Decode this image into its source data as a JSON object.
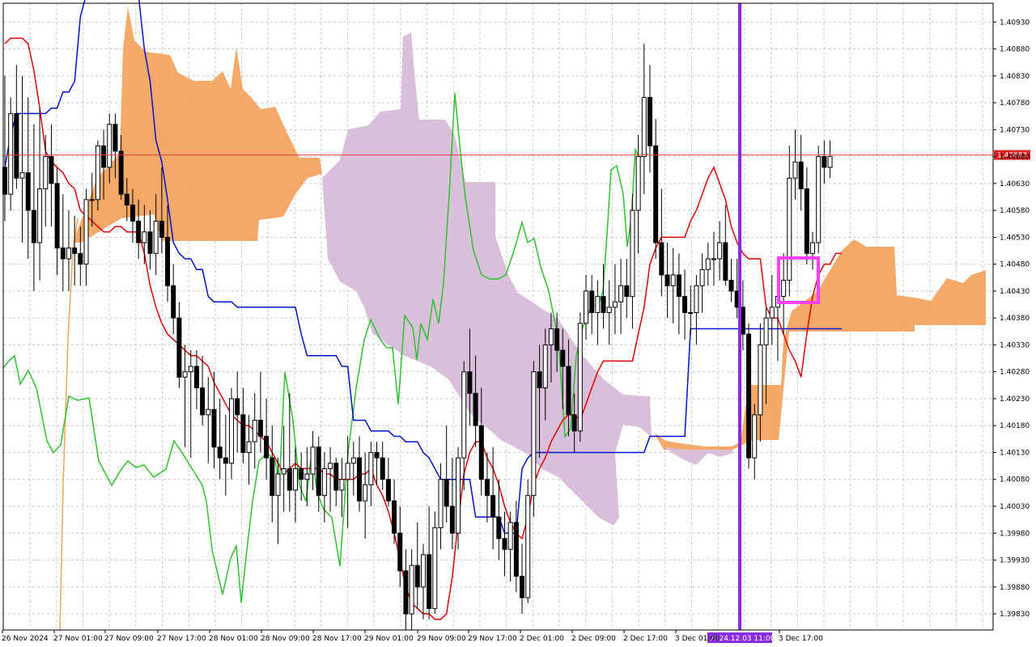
{
  "chart_data": {
    "type": "line",
    "symbol_hidden": true,
    "title": "",
    "y_axis": {
      "ticks": [
        "1.40930",
        "1.40880",
        "1.40830",
        "1.40780",
        "1.40730",
        "1.40680",
        "1.40630",
        "1.40580",
        "1.40530",
        "1.40480",
        "1.40430",
        "1.40380",
        "1.40330",
        "1.40280",
        "1.40230",
        "1.40180",
        "1.40130",
        "1.40080",
        "1.40030",
        "1.39980",
        "1.39930",
        "1.39880",
        "1.39830"
      ],
      "ylim": [
        1.398,
        1.40965
      ]
    },
    "x_axis": {
      "ticks": [
        "26 Nov 2024",
        "27 Nov 01:00",
        "27 Nov 09:00",
        "27 Nov 17:00",
        "28 Nov 01:00",
        "28 Nov 09:00",
        "28 Nov 17:00",
        "29 Nov 01:00",
        "29 Nov 09:00",
        "29 Nov 17:00",
        "2 Dec 01:00",
        "2 Dec 09:00",
        "2 Dec 17:00",
        "3 Dec 01:00",
        "3 Dec 17:00"
      ],
      "highlight_label": "2024.12.03 11:00"
    },
    "current_price": "1.40683",
    "colors": {
      "background": "#ffffff",
      "grid": "#c8c8c8",
      "bull": "#ffffff",
      "bear": "#000000",
      "tenkan": "#e00000",
      "kijun": "#0010d0",
      "chikou": "#30c030",
      "cloud_bull": "#f4a460",
      "cloud_bear": "#d8bcd8",
      "vline": "#8a2be2",
      "marker": "#ff40ff",
      "price_line": "#e04040",
      "price_tag_bg": "#e02020",
      "time_tag_bg": "#8a2be2"
    },
    "candles": [
      [
        1.4066,
        1.4083,
        1.4056,
        1.4061
      ],
      [
        1.4061,
        1.4079,
        1.4058,
        1.4076
      ],
      [
        1.4076,
        1.4085,
        1.4062,
        1.4064
      ],
      [
        1.4064,
        1.4083,
        1.4052,
        1.4065
      ],
      [
        1.4065,
        1.4079,
        1.4049,
        1.4058
      ],
      [
        1.4058,
        1.4074,
        1.4043,
        1.4052
      ],
      [
        1.4052,
        1.4077,
        1.4045,
        1.4062
      ],
      [
        1.4062,
        1.4072,
        1.4055,
        1.4068
      ],
      [
        1.4068,
        1.4074,
        1.4055,
        1.4063
      ],
      [
        1.4063,
        1.4066,
        1.4046,
        1.4051
      ],
      [
        1.4051,
        1.4061,
        1.4043,
        1.4049
      ],
      [
        1.4049,
        1.4058,
        1.4043,
        1.4051
      ],
      [
        1.4051,
        1.4057,
        1.4044,
        1.405
      ],
      [
        1.405,
        1.4055,
        1.4044,
        1.4048
      ],
      [
        1.4048,
        1.4062,
        1.4044,
        1.406
      ],
      [
        1.406,
        1.4065,
        1.4055,
        1.406
      ],
      [
        1.406,
        1.4071,
        1.4058,
        1.407
      ],
      [
        1.407,
        1.4073,
        1.406,
        1.4066
      ],
      [
        1.4066,
        1.4076,
        1.4063,
        1.4074
      ],
      [
        1.4074,
        1.4076,
        1.4064,
        1.4069
      ],
      [
        1.4069,
        1.4072,
        1.406,
        1.4061
      ],
      [
        1.4061,
        1.4064,
        1.4056,
        1.4059
      ],
      [
        1.4059,
        1.4062,
        1.4052,
        1.4056
      ],
      [
        1.4056,
        1.406,
        1.4049,
        1.4052
      ],
      [
        1.4052,
        1.4059,
        1.4048,
        1.4054
      ],
      [
        1.4054,
        1.4058,
        1.4047,
        1.405
      ],
      [
        1.405,
        1.4061,
        1.4046,
        1.4056
      ],
      [
        1.4056,
        1.4066,
        1.405,
        1.4053
      ],
      [
        1.4053,
        1.4059,
        1.4041,
        1.4044
      ],
      [
        1.4044,
        1.4048,
        1.4035,
        1.4038
      ],
      [
        1.4038,
        1.4041,
        1.4025,
        1.4027
      ],
      [
        1.4027,
        1.4033,
        1.4014,
        1.4028
      ],
      [
        1.4028,
        1.4032,
        1.4012,
        1.4029
      ],
      [
        1.4029,
        1.4032,
        1.4021,
        1.4025
      ],
      [
        1.4025,
        1.4031,
        1.4018,
        1.402
      ],
      [
        1.402,
        1.4027,
        1.4011,
        1.4021
      ],
      [
        1.4021,
        1.4028,
        1.401,
        1.4014
      ],
      [
        1.4014,
        1.4023,
        1.4008,
        1.4012
      ],
      [
        1.4012,
        1.402,
        1.4005,
        1.4011
      ],
      [
        1.4011,
        1.4025,
        1.4008,
        1.4023
      ],
      [
        1.4023,
        1.4028,
        1.4013,
        1.402
      ],
      [
        1.402,
        1.4025,
        1.4011,
        1.4013
      ],
      [
        1.4013,
        1.402,
        1.4007,
        1.4015
      ],
      [
        1.4015,
        1.4024,
        1.401,
        1.4019
      ],
      [
        1.4019,
        1.4028,
        1.4013,
        1.4016
      ],
      [
        1.4016,
        1.4023,
        1.4008,
        1.4012
      ],
      [
        1.4012,
        1.4018,
        1.4,
        1.4005
      ],
      [
        1.4005,
        1.4012,
        1.3996,
        1.4009
      ],
      [
        1.4009,
        1.4018,
        1.4002,
        1.401
      ],
      [
        1.401,
        1.4024,
        1.4002,
        1.4006
      ],
      [
        1.4006,
        1.4014,
        1.4,
        1.401
      ],
      [
        1.401,
        1.4013,
        1.4004,
        1.4008
      ],
      [
        1.4008,
        1.4014,
        1.4003,
        1.4009
      ],
      [
        1.4009,
        1.4017,
        1.4006,
        1.4014
      ],
      [
        1.4014,
        1.4016,
        1.4002,
        1.4005
      ],
      [
        1.4005,
        1.4013,
        1.4,
        1.401
      ],
      [
        1.401,
        1.4014,
        1.4002,
        1.4011
      ],
      [
        1.4011,
        1.4012,
        1.4003,
        1.4006
      ],
      [
        1.4006,
        1.4012,
        1.4001,
        1.4008
      ],
      [
        1.4008,
        1.4016,
        1.3999,
        1.4011
      ],
      [
        1.4011,
        1.4015,
        1.4005,
        1.4012
      ],
      [
        1.4012,
        1.4016,
        1.4002,
        1.4004
      ],
      [
        1.4004,
        1.4013,
        1.3997,
        1.4007
      ],
      [
        1.4007,
        1.4015,
        1.4003,
        1.4013
      ],
      [
        1.4013,
        1.4015,
        1.4007,
        1.4012
      ],
      [
        1.4012,
        1.4015,
        1.4006,
        1.4008
      ],
      [
        1.4008,
        1.4012,
        1.4003,
        1.4004
      ],
      [
        1.4004,
        1.4008,
        1.3996,
        1.3998
      ],
      [
        1.3998,
        1.4003,
        1.3988,
        1.3991
      ],
      [
        1.3991,
        1.3995,
        1.398,
        1.3983
      ],
      [
        1.3983,
        1.3995,
        1.398,
        1.3992
      ],
      [
        1.3992,
        1.4,
        1.3984,
        1.3988
      ],
      [
        1.3988,
        1.3996,
        1.3982,
        1.3994
      ],
      [
        1.3994,
        1.4003,
        1.3982,
        1.3984
      ],
      [
        1.3984,
        1.4002,
        1.3983,
        1.3999
      ],
      [
        1.3999,
        1.4011,
        1.3995,
        1.4008
      ],
      [
        1.4008,
        1.4018,
        1.4,
        1.4003
      ],
      [
        1.4003,
        1.4012,
        1.3995,
        1.3998
      ],
      [
        1.3998,
        1.4014,
        1.3995,
        1.4012
      ],
      [
        1.4012,
        1.403,
        1.4006,
        1.4028
      ],
      [
        1.4028,
        1.4036,
        1.4018,
        1.4024
      ],
      [
        1.4024,
        1.4031,
        1.4014,
        1.4018
      ],
      [
        1.4018,
        1.4025,
        1.4005,
        1.4008
      ],
      [
        1.4008,
        1.4013,
        1.4,
        1.4005
      ],
      [
        1.4005,
        1.4014,
        1.3995,
        1.4001
      ],
      [
        1.4001,
        1.4008,
        1.3993,
        1.3997
      ],
      [
        1.3997,
        1.4002,
        1.399,
        1.3995
      ],
      [
        1.3995,
        1.4002,
        1.3989,
        1.4
      ],
      [
        1.4,
        1.4004,
        1.3987,
        1.399
      ],
      [
        1.399,
        1.3996,
        1.3983,
        1.3986
      ],
      [
        1.3986,
        1.4008,
        1.3985,
        1.4005
      ],
      [
        1.4005,
        1.403,
        1.4001,
        1.4028
      ],
      [
        1.4028,
        1.4033,
        1.4012,
        1.4025
      ],
      [
        1.4025,
        1.4036,
        1.4019,
        1.4033
      ],
      [
        1.4033,
        1.4039,
        1.4026,
        1.4036
      ],
      [
        1.4036,
        1.4039,
        1.4028,
        1.4032
      ],
      [
        1.4032,
        1.4036,
        1.4021,
        1.4029
      ],
      [
        1.4029,
        1.4034,
        1.4016,
        1.402
      ],
      [
        1.402,
        1.4024,
        1.4013,
        1.4017
      ],
      [
        1.4017,
        1.4039,
        1.4015,
        1.4037
      ],
      [
        1.4037,
        1.4046,
        1.4034,
        1.4043
      ],
      [
        1.4043,
        1.4046,
        1.4035,
        1.4039
      ],
      [
        1.4039,
        1.4045,
        1.4033,
        1.4042
      ],
      [
        1.4042,
        1.4048,
        1.4036,
        1.4039
      ],
      [
        1.4039,
        1.4045,
        1.4033,
        1.404
      ],
      [
        1.404,
        1.4048,
        1.4035,
        1.4041
      ],
      [
        1.4041,
        1.4049,
        1.4035,
        1.4044
      ],
      [
        1.4044,
        1.4049,
        1.4038,
        1.4042
      ],
      [
        1.4042,
        1.4061,
        1.4036,
        1.4058
      ],
      [
        1.4058,
        1.4072,
        1.405,
        1.4068
      ],
      [
        1.4068,
        1.4089,
        1.4061,
        1.4079
      ],
      [
        1.4079,
        1.4085,
        1.4065,
        1.407
      ],
      [
        1.407,
        1.4075,
        1.4049,
        1.4052
      ],
      [
        1.4052,
        1.4062,
        1.4042,
        1.4046
      ],
      [
        1.4046,
        1.4052,
        1.4038,
        1.4044
      ],
      [
        1.4044,
        1.4051,
        1.4037,
        1.4046
      ],
      [
        1.4046,
        1.405,
        1.4035,
        1.4042
      ],
      [
        1.4042,
        1.4047,
        1.4034,
        1.4039
      ],
      [
        1.4039,
        1.4044,
        1.4035,
        1.4039
      ],
      [
        1.4039,
        1.4046,
        1.4033,
        1.4044
      ],
      [
        1.4044,
        1.405,
        1.4039,
        1.4047
      ],
      [
        1.4047,
        1.4052,
        1.4044,
        1.4049
      ],
      [
        1.4049,
        1.4054,
        1.4044,
        1.4049
      ],
      [
        1.4049,
        1.4056,
        1.4045,
        1.4052
      ],
      [
        1.4052,
        1.4059,
        1.4044,
        1.4045
      ],
      [
        1.4045,
        1.4049,
        1.4041,
        1.4043
      ],
      [
        1.4043,
        1.4049,
        1.4038,
        1.404
      ],
      [
        1.404,
        1.4045,
        1.4032,
        1.4035
      ],
      [
        1.4035,
        1.4037,
        1.401,
        1.4012
      ],
      [
        1.4012,
        1.4022,
        1.4008,
        1.402
      ],
      [
        1.402,
        1.4037,
        1.4015,
        1.4033
      ],
      [
        1.4033,
        1.404,
        1.4022,
        1.4038
      ],
      [
        1.4038,
        1.4046,
        1.4033,
        1.404
      ],
      [
        1.404,
        1.4044,
        1.403,
        1.4042
      ],
      [
        1.4042,
        1.405,
        1.4035,
        1.4045
      ],
      [
        1.4045,
        1.407,
        1.4042,
        1.4064
      ],
      [
        1.4064,
        1.4073,
        1.406,
        1.4067
      ],
      [
        1.4067,
        1.4072,
        1.4058,
        1.4062
      ],
      [
        1.4062,
        1.4066,
        1.4048,
        1.405
      ],
      [
        1.405,
        1.4054,
        1.4047,
        1.4052
      ],
      [
        1.4052,
        1.407,
        1.405,
        1.4068
      ],
      [
        1.4068,
        1.4071,
        1.4063,
        1.4066
      ],
      [
        1.4066,
        1.4071,
        1.4064,
        1.4068
      ]
    ],
    "tenkan": [
      1.4089,
      1.409,
      1.409,
      1.409,
      1.4089,
      1.4084,
      1.4077,
      1.4069,
      1.4067,
      1.4066,
      1.4065,
      1.4063,
      1.4062,
      1.4058,
      1.4057,
      1.4056,
      1.4055,
      1.4054,
      1.4054,
      1.4055,
      1.4055,
      1.4054,
      1.4054,
      1.4054,
      1.405,
      1.4044,
      1.404,
      1.4037,
      1.4035,
      1.4034,
      1.4033,
      1.4032,
      1.4031,
      1.4031,
      1.403,
      1.4029,
      1.4026,
      1.4024,
      1.4022,
      1.402,
      1.4019,
      1.4018,
      1.4018,
      1.4017,
      1.4016,
      1.4015,
      1.4013,
      1.4011,
      1.4009,
      1.401,
      1.4011,
      1.401,
      1.401,
      1.401,
      1.401,
      1.4009,
      1.4009,
      1.4008,
      1.4008,
      1.4008,
      1.4008,
      1.4009,
      1.4009,
      1.401,
      1.4007,
      1.4005,
      1.4002,
      1.3998,
      1.3993,
      1.3988,
      1.3985,
      1.3984,
      1.3983,
      1.3983,
      1.3982,
      1.3982,
      1.3983,
      1.399,
      1.4,
      1.4009,
      1.4013,
      1.4015,
      1.4015,
      1.4012,
      1.401,
      1.4007,
      1.4003,
      1.4,
      1.3998,
      1.3997,
      1.4001,
      1.4007,
      1.401,
      1.4012,
      1.4015,
      1.4017,
      1.4019,
      1.402,
      1.402,
      1.4019,
      1.4022,
      1.4025,
      1.4028,
      1.403,
      1.403,
      1.403,
      1.403,
      1.403,
      1.403,
      1.4035,
      1.404,
      1.4048,
      1.4051,
      1.4053,
      1.4053,
      1.4053,
      1.4053,
      1.4053,
      1.4056,
      1.4058,
      1.4061,
      1.4064,
      1.4066,
      1.4063,
      1.406,
      1.4055,
      1.4052,
      1.405,
      1.4049,
      1.4049,
      1.4049,
      1.404,
      1.4038,
      1.4038,
      1.4035,
      1.4032,
      1.403,
      1.4027,
      1.4035,
      1.4042,
      1.4046,
      1.4048,
      1.4048,
      1.405,
      1.405
    ],
    "kijun": [
      1.4066,
      1.4072,
      1.4076,
      1.4076,
      1.4076,
      1.4076,
      1.4076,
      1.4076,
      1.4077,
      1.4077,
      1.408,
      1.408,
      1.4082,
      1.4094,
      1.4098,
      1.4098,
      1.4098,
      1.4098,
      1.4098,
      1.4098,
      1.4098,
      1.4098,
      1.4098,
      1.4098,
      1.4088,
      1.4082,
      1.4071,
      1.4067,
      1.406,
      1.4052,
      1.405,
      1.4049,
      1.4049,
      1.4047,
      1.4047,
      1.4042,
      1.4041,
      1.4041,
      1.4041,
      1.4041,
      1.404,
      1.404,
      1.404,
      1.404,
      1.404,
      1.404,
      1.404,
      1.404,
      1.404,
      1.404,
      1.404,
      1.4035,
      1.4031,
      1.4031,
      1.4031,
      1.4031,
      1.4031,
      1.4031,
      1.4029,
      1.4029,
      1.4019,
      1.4019,
      1.4019,
      1.4017,
      1.4017,
      1.4017,
      1.4017,
      1.4016,
      1.4016,
      1.4015,
      1.4015,
      1.4015,
      1.4013,
      1.4012,
      1.401,
      1.4008,
      1.4008,
      1.4008,
      1.4008,
      1.4008,
      1.4008,
      1.4001,
      1.4001,
      1.4001,
      1.4001,
      1.4001,
      1.3998,
      1.3998,
      1.3998,
      1.401,
      1.4012,
      1.4013,
      1.4013,
      1.4013,
      1.4013,
      1.4013,
      1.4013,
      1.4013,
      1.4013,
      1.4013,
      1.4013,
      1.4013,
      1.4013,
      1.4013,
      1.4013,
      1.4013,
      1.4013,
      1.4013,
      1.4013,
      1.4013,
      1.4013,
      1.4016,
      1.4016,
      1.4016,
      1.4016,
      1.4016,
      1.4016,
      1.4016,
      1.4036,
      1.4036,
      1.4036,
      1.4036,
      1.4036,
      1.4036,
      1.4036,
      1.4036,
      1.4036,
      1.4036,
      1.4036,
      1.4036,
      1.4036,
      1.4036,
      1.4036,
      1.4036,
      1.4036,
      1.4036,
      1.4036,
      1.4036,
      1.4036,
      1.4036,
      1.4036,
      1.4036,
      1.4036,
      1.4036,
      1.4036
    ]
  }
}
